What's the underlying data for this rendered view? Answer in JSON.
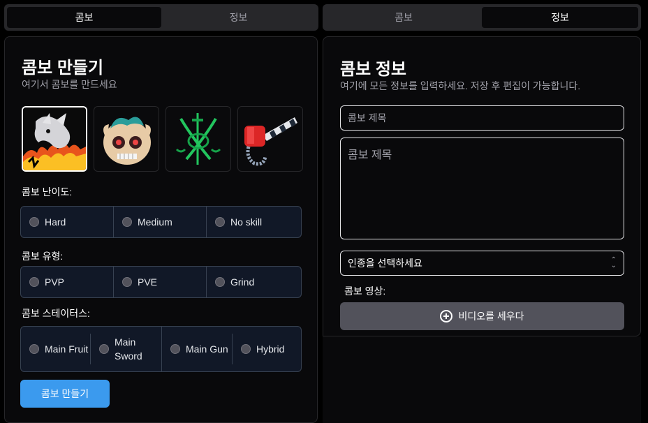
{
  "left_tabs": [
    {
      "label": "콤보",
      "active": true
    },
    {
      "label": "정보",
      "active": false
    }
  ],
  "right_tabs": [
    {
      "label": "콤보",
      "active": false
    },
    {
      "label": "정보",
      "active": true
    }
  ],
  "combo_builder": {
    "title": "콤보 만들기",
    "subtitle": "여기서 콤보를 만드세요",
    "avatars": [
      {
        "name": "dragon-fruit-icon",
        "selected": true
      },
      {
        "name": "skull-fruit-icon",
        "selected": false
      },
      {
        "name": "crossed-swords-icon",
        "selected": false
      },
      {
        "name": "gun-icon",
        "selected": false
      }
    ],
    "difficulty": {
      "label": "콤보 난이도:",
      "options": [
        "Hard",
        "Medium",
        "No skill"
      ]
    },
    "type": {
      "label": "콤보 유형:",
      "options": [
        "PVP",
        "PVE",
        "Grind"
      ]
    },
    "status": {
      "label": "콤보 스테이터스:",
      "options": [
        "Main Fruit",
        "Main Sword",
        "Main Gun",
        "Hybrid"
      ]
    },
    "submit_label": "콤보 만들기"
  },
  "combo_info": {
    "title": "콤보 정보",
    "subtitle": "여기에 모든 정보를 입력하세요. 저장 후 편집이 가능합니다.",
    "title_placeholder": "콤보 제목",
    "description_placeholder": "콤보 제목",
    "race_select": "인종을 선택하세요",
    "video_label": "콤보 영상:",
    "video_button": "비디오를 세우다"
  },
  "colors": {
    "accent": "#3b9aee",
    "background": "#09090b",
    "radio_group_bg": "#111827"
  }
}
